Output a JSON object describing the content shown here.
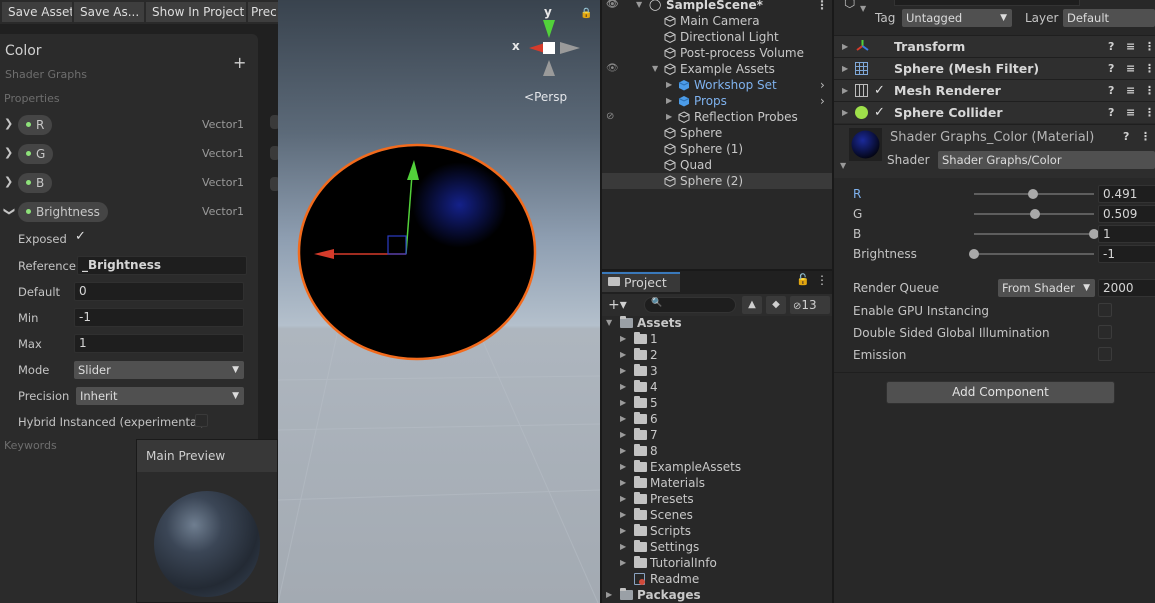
{
  "toolbar": {
    "save_asset": "Save Asset",
    "save_as": "Save As...",
    "show_in_project": "Show In Project",
    "precision": "Prec"
  },
  "blackboard": {
    "title": "Color",
    "subtitle": "Shader Graphs",
    "add": "+",
    "properties_label": "Properties",
    "keywords_label": "Keywords",
    "properties": [
      {
        "name": "R",
        "type": "Vector1"
      },
      {
        "name": "G",
        "type": "Vector1"
      },
      {
        "name": "B",
        "type": "Vector1"
      },
      {
        "name": "Brightness",
        "type": "Vector1"
      }
    ],
    "fields": {
      "exposed_label": "Exposed",
      "reference_label": "Reference",
      "reference_value": "_Brightness",
      "default_label": "Default",
      "default_value": "0",
      "min_label": "Min",
      "min_value": "-1",
      "max_label": "Max",
      "max_value": "1",
      "mode_label": "Mode",
      "mode_value": "Slider",
      "precision_label": "Precision",
      "precision_value": "Inherit",
      "hybrid_label": "Hybrid Instanced (experimental)"
    }
  },
  "main_preview": {
    "title": "Main Preview"
  },
  "scene": {
    "gizmo_y": "y",
    "gizmo_x": "x",
    "persp": "Persp"
  },
  "hierarchy": {
    "scene_name": "SampleScene*",
    "items": [
      {
        "label": "Main Camera"
      },
      {
        "label": "Directional Light"
      },
      {
        "label": "Post-process Volume"
      },
      {
        "label": "Example Assets"
      },
      {
        "label": "Workshop Set"
      },
      {
        "label": "Props"
      },
      {
        "label": "Reflection Probes"
      },
      {
        "label": "Sphere"
      },
      {
        "label": "Sphere (1)"
      },
      {
        "label": "Quad"
      },
      {
        "label": "Sphere (2)"
      }
    ]
  },
  "project": {
    "tab": "Project",
    "hidden_count": "13",
    "assets_label": "Assets",
    "folders": [
      "1",
      "2",
      "3",
      "4",
      "5",
      "6",
      "7",
      "8",
      "ExampleAssets",
      "Materials",
      "Presets",
      "Scenes",
      "Scripts",
      "Settings",
      "TutorialInfo"
    ],
    "readme": "Readme",
    "packages_label": "Packages"
  },
  "inspector": {
    "tag_label": "Tag",
    "tag_value": "Untagged",
    "layer_label": "Layer",
    "layer_value": "Default",
    "components": [
      {
        "name": "Transform"
      },
      {
        "name": "Sphere (Mesh Filter)"
      },
      {
        "name": "Mesh Renderer"
      },
      {
        "name": "Sphere Collider"
      }
    ],
    "material_name": "Shader Graphs_Color (Material)",
    "shader_label": "Shader",
    "shader_value": "Shader Graphs/Color",
    "sliders": [
      {
        "label": "R",
        "value": "0.491",
        "fraction": 0.491
      },
      {
        "label": "G",
        "value": "0.509",
        "fraction": 0.509
      },
      {
        "label": "B",
        "value": "1",
        "fraction": 1.0
      },
      {
        "label": "Brightness",
        "value": "-1",
        "fraction": 0.0
      }
    ],
    "render_queue_label": "Render Queue",
    "render_queue_mode": "From Shader",
    "render_queue_value": "2000",
    "toggles": [
      {
        "label": "Enable GPU Instancing"
      },
      {
        "label": "Double Sided Global Illumination"
      },
      {
        "label": "Emission"
      }
    ],
    "add_component": "Add Component"
  },
  "colors": {
    "accent_blue": "#3a79bb",
    "prefab_blue": "#7fb2ee",
    "selection_orange": "#f26b1d",
    "property_dot_green": "#8ee27a"
  }
}
